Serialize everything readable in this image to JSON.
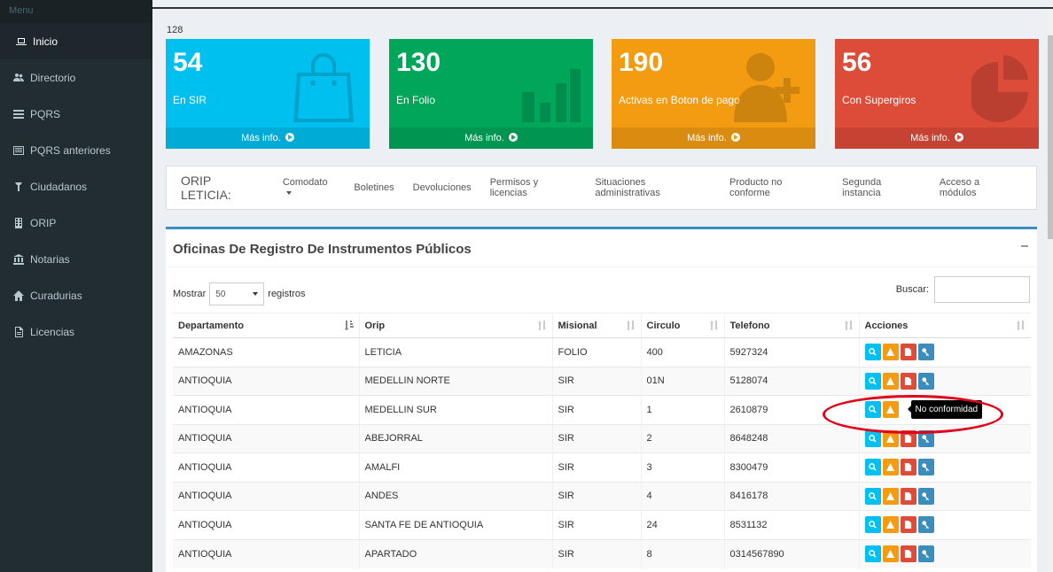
{
  "sidebar": {
    "header": "Menu",
    "items": [
      {
        "label": "Inicio",
        "icon": "laptop-icon"
      },
      {
        "label": "Directorio",
        "icon": "users-icon"
      },
      {
        "label": "PQRS",
        "icon": "list-icon"
      },
      {
        "label": "PQRS anteriores",
        "icon": "list-alt-icon"
      },
      {
        "label": "Ciudadanos",
        "icon": "user-icon"
      },
      {
        "label": "ORIP",
        "icon": "building-icon"
      },
      {
        "label": "Notarias",
        "icon": "institution-icon"
      },
      {
        "label": "Curadurias",
        "icon": "home-icon"
      },
      {
        "label": "Licencias",
        "icon": "file-icon"
      }
    ]
  },
  "counter": "128",
  "stats": [
    {
      "number": "54",
      "label": "En SIR",
      "more": "Más info.",
      "color": "#00c0ef",
      "icon": "shopping-bag-icon"
    },
    {
      "number": "130",
      "label": "En Folio",
      "more": "Más info.",
      "color": "#00a65a",
      "icon": "bar-chart-icon"
    },
    {
      "number": "190",
      "label": "Activas en Boton de pago",
      "more": "Más info.",
      "color": "#f39c12",
      "icon": "user-add-icon"
    },
    {
      "number": "56",
      "label": "Con Supergiros",
      "more": "Más info.",
      "color": "#dd4b39",
      "icon": "pie-chart-icon"
    }
  ],
  "nav": {
    "orip": "ORIP LETICIA:",
    "links": [
      "Comodato",
      "Boletines",
      "Devoluciones",
      "Permisos y licencias",
      "Situaciones administrativas",
      "Producto no conforme",
      "Segunda instancia",
      "Acceso a módulos"
    ]
  },
  "panel": {
    "title": "Oficinas De Registro De Instrumentos Públicos",
    "show_prefix": "Mostrar",
    "show_value": "50",
    "show_suffix": "registros",
    "search_label": "Buscar:",
    "search_value": ""
  },
  "table": {
    "headers": [
      "Departamento",
      "Orip",
      "Misional",
      "Circulo",
      "Telefono",
      "Acciones"
    ],
    "rows": [
      [
        "AMAZONAS",
        "LETICIA",
        "FOLIO",
        "400",
        "5927324"
      ],
      [
        "ANTIOQUIA",
        "MEDELLIN NORTE",
        "SIR",
        "01N",
        "5128074"
      ],
      [
        "ANTIOQUIA",
        "MEDELLIN SUR",
        "SIR",
        "1",
        "2610879"
      ],
      [
        "ANTIOQUIA",
        "ABEJORRAL",
        "SIR",
        "2",
        "8648248"
      ],
      [
        "ANTIOQUIA",
        "AMALFI",
        "SIR",
        "3",
        "8300479"
      ],
      [
        "ANTIOQUIA",
        "ANDES",
        "SIR",
        "4",
        "8416178"
      ],
      [
        "ANTIOQUIA",
        "SANTA FE DE ANTIOQUIA",
        "SIR",
        "24",
        "8531132"
      ],
      [
        "ANTIOQUIA",
        "APARTADO",
        "SIR",
        "8",
        "0314567890"
      ]
    ],
    "tooltip": "No conformidad"
  }
}
